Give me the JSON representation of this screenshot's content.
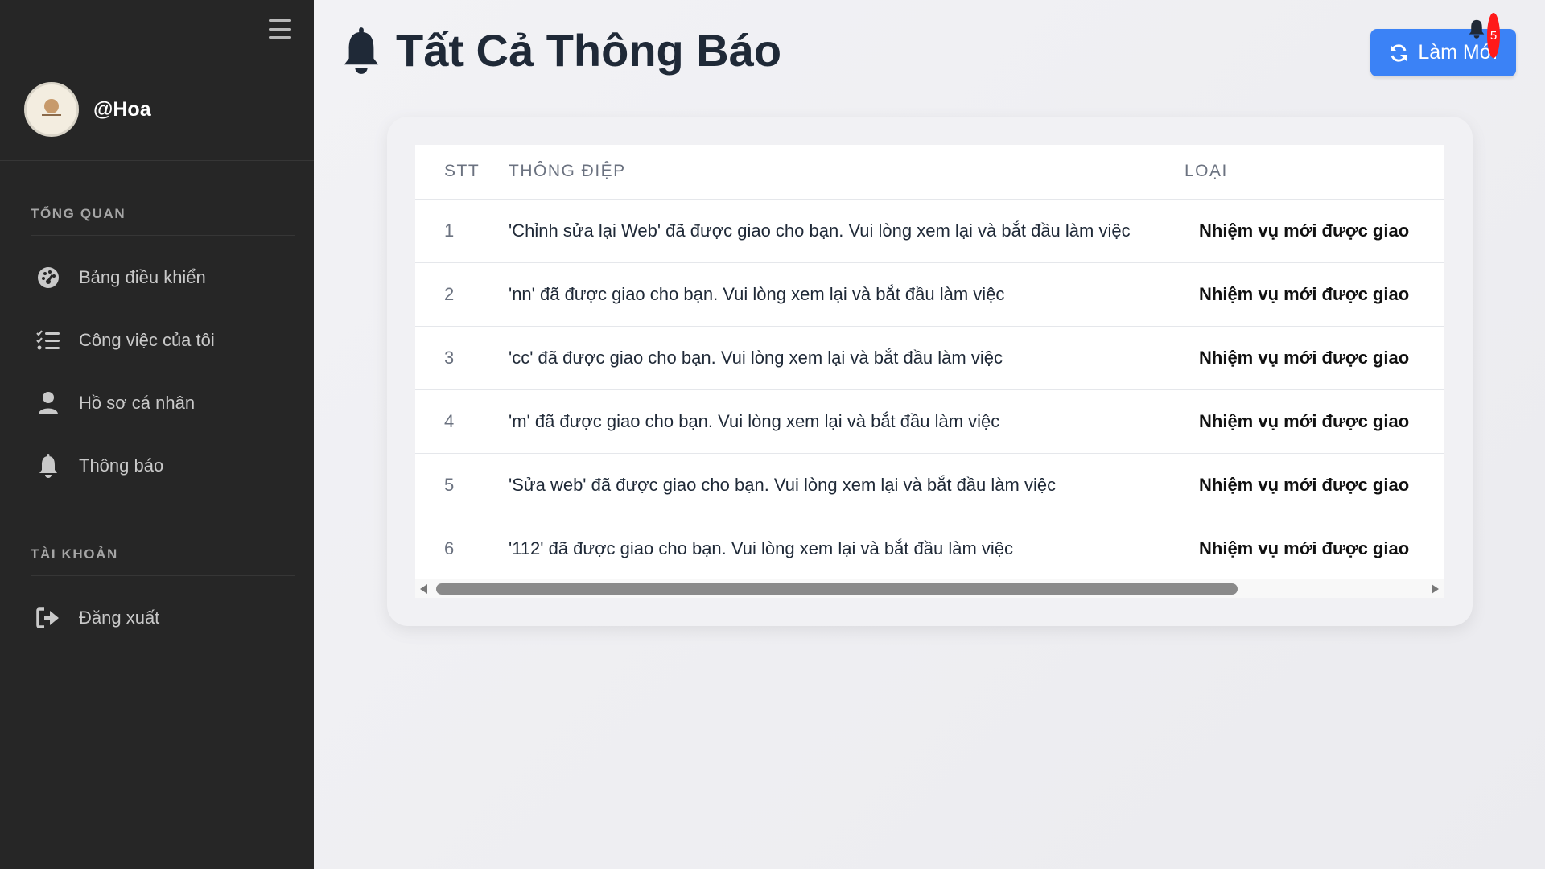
{
  "sidebar": {
    "username": "@Hoa",
    "sections": [
      {
        "label": "TỔNG QUAN"
      },
      {
        "label": "TÀI KHOẢN"
      }
    ],
    "items": [
      {
        "label": "Bảng điều khiển",
        "icon": "dashboard-icon"
      },
      {
        "label": "Công việc của tôi",
        "icon": "task-list-icon"
      },
      {
        "label": "Hồ sơ cá nhân",
        "icon": "user-icon"
      },
      {
        "label": "Thông báo",
        "icon": "bell-icon"
      },
      {
        "label": "Đăng xuất",
        "icon": "logout-icon"
      }
    ]
  },
  "header": {
    "title": "Tất Cả Thông Báo",
    "refresh_label": "Làm Mới",
    "notification_count": "5"
  },
  "table": {
    "columns": [
      "STT",
      "THÔNG ĐIỆP",
      "LOẠI"
    ],
    "rows": [
      {
        "stt": "1",
        "message": "'Chỉnh sửa lại Web' đã được giao cho bạn. Vui lòng xem lại và bắt đầu làm việc",
        "type": "Nhiệm vụ mới được giao"
      },
      {
        "stt": "2",
        "message": "'nn' đã được giao cho bạn. Vui lòng xem lại và bắt đầu làm việc",
        "type": "Nhiệm vụ mới được giao"
      },
      {
        "stt": "3",
        "message": "'cc' đã được giao cho bạn. Vui lòng xem lại và bắt đầu làm việc",
        "type": "Nhiệm vụ mới được giao"
      },
      {
        "stt": "4",
        "message": "'m' đã được giao cho bạn. Vui lòng xem lại và bắt đầu làm việc",
        "type": "Nhiệm vụ mới được giao"
      },
      {
        "stt": "5",
        "message": "'Sửa web' đã được giao cho bạn. Vui lòng xem lại và bắt đầu làm việc",
        "type": "Nhiệm vụ mới được giao"
      },
      {
        "stt": "6",
        "message": "'112' đã được giao cho bạn. Vui lòng xem lại và bắt đầu làm việc",
        "type": "Nhiệm vụ mới được giao"
      }
    ]
  },
  "colors": {
    "sidebar_bg": "#262626",
    "accent": "#3b82f6",
    "badge": "#ff1a1a"
  }
}
